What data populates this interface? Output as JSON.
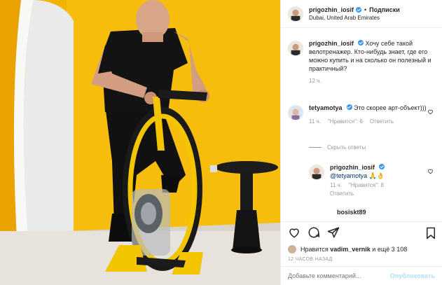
{
  "header": {
    "username": "prigozhin_iosif",
    "separator": "•",
    "follow_label": "Подписки",
    "location": "Dubai, United Arab Emirates"
  },
  "comments": [
    {
      "username": "prigozhin_iosif",
      "text": "Хочу себе такой велотренажер. Кто-нибудь знает, где его можно купить и на сколько он полезный и практичный?",
      "time": "12 ч."
    },
    {
      "username": "tetyamotya",
      "text": "Это скорее арт-объект)))",
      "time": "11 ч.",
      "likes": "\"Нравится\": 6",
      "reply": "Ответить"
    },
    {
      "username": "prigozhin_iosif",
      "mention": "@tetyamotya",
      "emoji": "🙏👌",
      "time": "11 ч.",
      "likes": "\"Нравится\": 8",
      "reply": "Ответить"
    },
    {
      "username_partial": "bosiskt89"
    }
  ],
  "hide_replies": "Скрыть ответы",
  "likes": {
    "prefix": "Нравится",
    "user": "vadim_vernik",
    "suffix": "и ещё 3 108"
  },
  "timeago": "12 ЧАСОВ НАЗАД",
  "add_comment": {
    "placeholder": "Добавьте комментарий...",
    "publish_label": "Опубликовать"
  },
  "colors": {
    "wall_yellow": "#f2b705",
    "verified_blue": "#3897f0",
    "link_blue": "#003569"
  }
}
